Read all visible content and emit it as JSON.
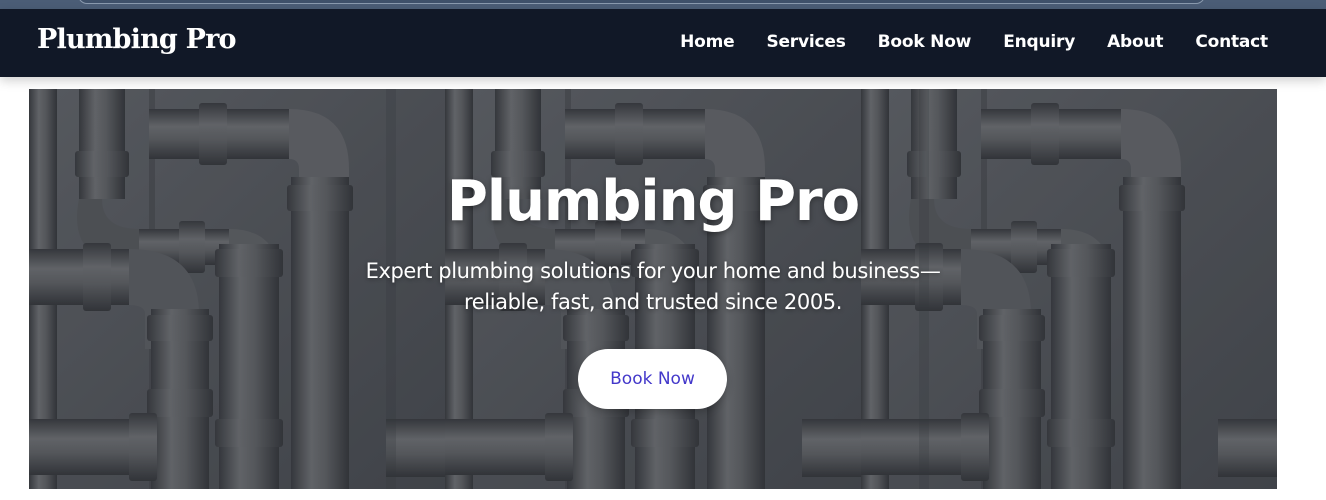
{
  "nav": {
    "brand": "Plumbing Pro",
    "links": [
      "Home",
      "Services",
      "Book Now",
      "Enquiry",
      "About",
      "Contact"
    ]
  },
  "hero": {
    "title": "Plumbing Pro",
    "subtitle": "Expert plumbing solutions for your home and business—reliable, fast, and trusted since 2005.",
    "cta_label": "Book Now",
    "background": "grey-pvc-pipes-on-concrete-wall"
  },
  "colors": {
    "nav_bg": "#111827",
    "nav_text": "#ffffff",
    "cta_text": "#4338ca",
    "cta_bg": "#ffffff"
  }
}
